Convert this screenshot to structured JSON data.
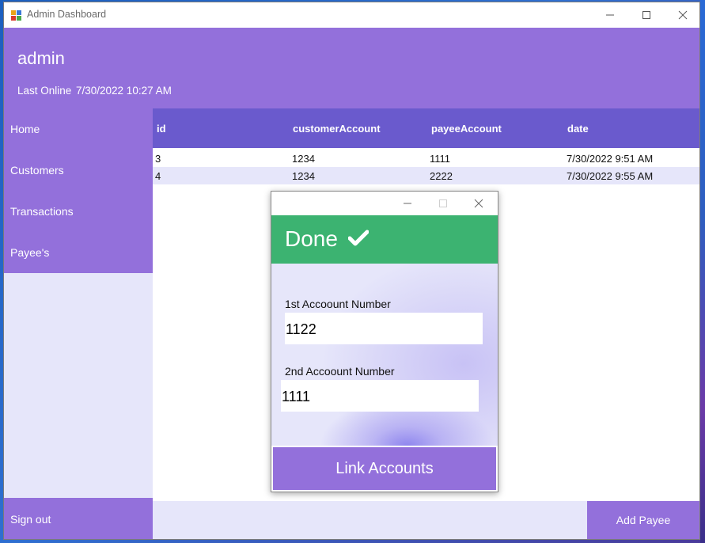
{
  "window": {
    "title": "Admin Dashboard"
  },
  "header": {
    "username": "admin",
    "last_online_label": "Last Online",
    "last_online_value": "7/30/2022 10:27 AM"
  },
  "sidebar": {
    "items": [
      {
        "label": "Home"
      },
      {
        "label": "Customers"
      },
      {
        "label": "Transactions"
      },
      {
        "label": "Payee's"
      }
    ],
    "signout_label": "Sign out"
  },
  "table": {
    "columns": [
      "id",
      "customerAccount",
      "payeeAccount",
      "date"
    ],
    "rows": [
      [
        "3",
        "1234",
        "1111",
        "7/30/2022 9:51 AM"
      ],
      [
        "4",
        "1234",
        "2222",
        "7/30/2022 9:55 AM"
      ]
    ]
  },
  "footer": {
    "add_payee_label": "Add Payee"
  },
  "dialog": {
    "status_text": "Done",
    "status_icon": "check-icon",
    "first_label": "1st Accoount Number",
    "first_value": "1122",
    "second_label": "2nd Accoount Number",
    "second_value": "1111",
    "submit_label": "Link Accounts"
  },
  "colors": {
    "accent": "#9370db",
    "grid_header": "#6a5acd",
    "panel_bg": "#e6e6fa",
    "success": "#3cb371"
  }
}
